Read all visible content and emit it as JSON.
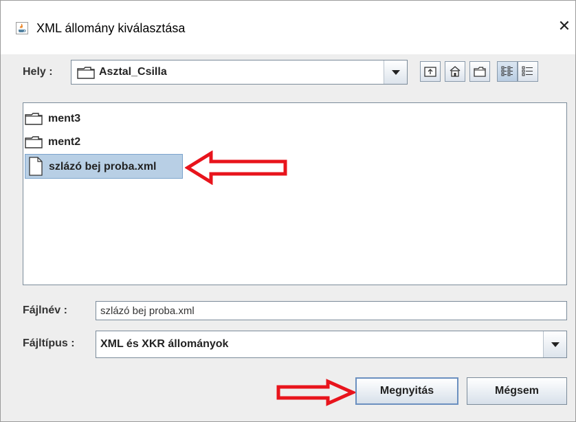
{
  "dialog": {
    "title": "XML állomány kiválasztása",
    "title_icon": "java-cup-icon",
    "close_symbol": "✕"
  },
  "location": {
    "label": "Hely :",
    "current": "Asztal_Csilla",
    "icon": "folder-icon"
  },
  "toolbar": {
    "buttons": [
      {
        "name": "up-one-level-icon",
        "active": false
      },
      {
        "name": "home-icon",
        "active": false
      },
      {
        "name": "new-folder-icon",
        "active": false
      },
      {
        "name": "list-view-icon",
        "active": true
      },
      {
        "name": "details-view-icon",
        "active": false
      }
    ]
  },
  "files": [
    {
      "name": "ment3",
      "type": "folder",
      "selected": false
    },
    {
      "name": "ment2",
      "type": "folder",
      "selected": false
    },
    {
      "name": "szlázó bej proba.xml",
      "type": "file",
      "selected": true
    }
  ],
  "filename": {
    "label": "Fájlnév :",
    "value": "szlázó bej proba.xml"
  },
  "filetype": {
    "label": "Fájltípus :",
    "selected": "XML és XKR állományok"
  },
  "buttons": {
    "open": "Megnyitás",
    "cancel": "Mégsem"
  },
  "annotation_color": "#e8141c"
}
